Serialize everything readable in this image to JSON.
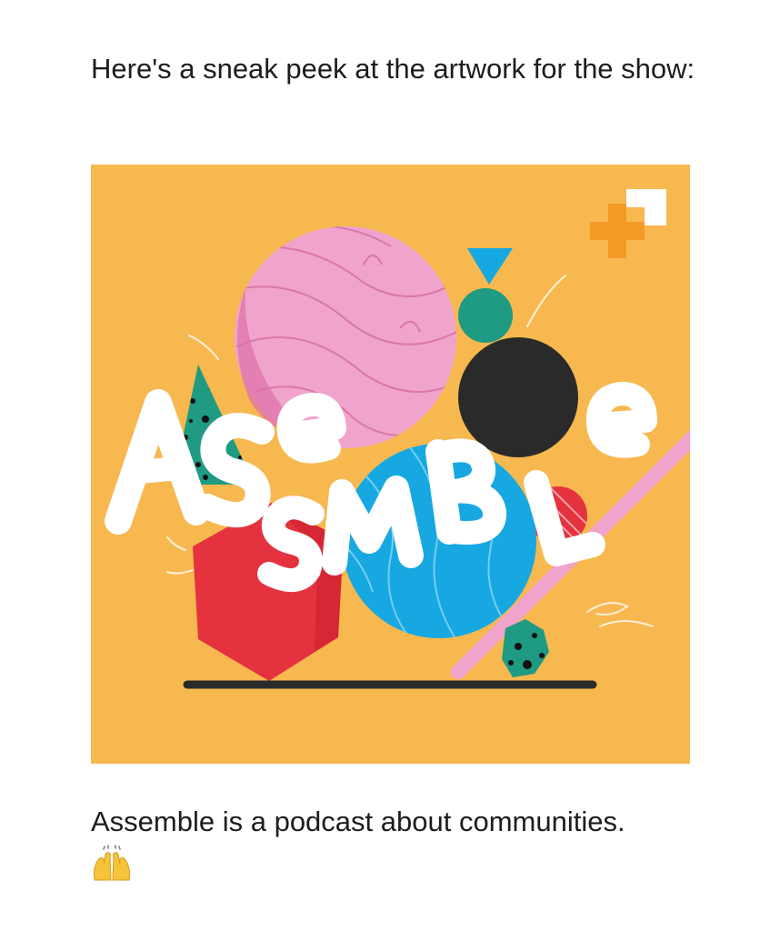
{
  "intro": {
    "text": "Here's a sneak peek at the artwork for the show:"
  },
  "artwork": {
    "title_text": "ASSEMBLE",
    "colors": {
      "background": "#F7B84F",
      "pink": "#F0A3CB",
      "blue": "#17A8E2",
      "red": "#E5323F",
      "teal": "#1F9A83",
      "black": "#2A2A2A",
      "orange_plus": "#F59A26",
      "white": "#FFFFFF"
    }
  },
  "caption": {
    "text": "Assemble is a podcast about communities.",
    "emoji_name": "raising-hands-emoji"
  }
}
